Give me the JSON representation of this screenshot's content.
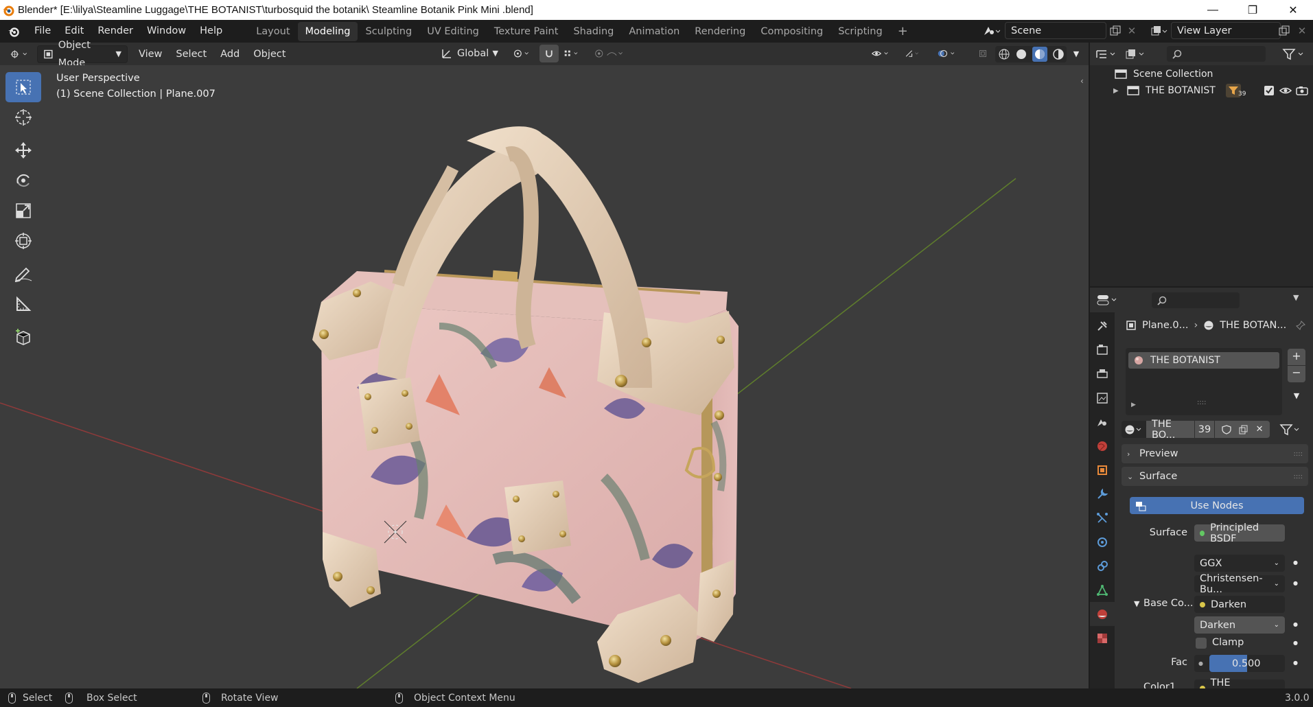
{
  "window": {
    "title": "Blender* [E:\\lilya\\Steamline Luggage\\THE BOTANIST\\turbosquid the botanik\\ Steamline Botanik Pink Mini  .blend]",
    "min_symbol": "—",
    "max_symbol": "❐",
    "close_symbol": "✕"
  },
  "menu": [
    "File",
    "Edit",
    "Render",
    "Window",
    "Help"
  ],
  "workspaces": [
    {
      "label": "Layout",
      "active": false
    },
    {
      "label": "Modeling",
      "active": true
    },
    {
      "label": "Sculpting",
      "active": false
    },
    {
      "label": "UV Editing",
      "active": false
    },
    {
      "label": "Texture Paint",
      "active": false
    },
    {
      "label": "Shading",
      "active": false
    },
    {
      "label": "Animation",
      "active": false
    },
    {
      "label": "Rendering",
      "active": false
    },
    {
      "label": "Compositing",
      "active": false
    },
    {
      "label": "Scripting",
      "active": false
    }
  ],
  "add_workspace": "+",
  "scene": {
    "label": "Scene"
  },
  "view_layer": {
    "label": "View Layer"
  },
  "viewport_header": {
    "mode": "Object Mode",
    "menus": [
      "View",
      "Select",
      "Add",
      "Object"
    ],
    "transform_orientation": "Global"
  },
  "viewport": {
    "info_line1": "User Perspective",
    "info_line2": "(1) Scene Collection | Plane.007"
  },
  "tools": [
    {
      "name": "select-box-tool",
      "icon": "cursor-select-icon",
      "selected": true
    },
    {
      "name": "cursor-tool",
      "icon": "cursor-3d-icon",
      "selected": false
    },
    {
      "name": "move-tool",
      "icon": "move-icon",
      "selected": false
    },
    {
      "name": "rotate-tool",
      "icon": "rotate-icon",
      "selected": false
    },
    {
      "name": "scale-tool",
      "icon": "scale-icon",
      "selected": false
    },
    {
      "name": "transform-tool",
      "icon": "transform-icon",
      "selected": false
    },
    {
      "name": "annotate-tool",
      "icon": "pencil-icon",
      "selected": false
    },
    {
      "name": "measure-tool",
      "icon": "ruler-icon",
      "selected": false
    },
    {
      "name": "add-cube-tool",
      "icon": "add-cube-icon",
      "selected": false
    }
  ],
  "outliner": {
    "root": "Scene Collection",
    "items": [
      {
        "label": "THE BOTANIST",
        "count": "39"
      }
    ]
  },
  "properties": {
    "breadcrumb_object": "Plane.0...",
    "breadcrumb_material": "THE BOTAN...",
    "material_slot": "THE BOTANIST",
    "material_name": "THE BO...",
    "material_users": "39",
    "panels": {
      "preview": "Preview",
      "surface": "Surface"
    },
    "use_nodes": "Use Nodes",
    "surface_label": "Surface",
    "surface_value": "Principled BSDF",
    "distribution": "GGX",
    "subsurface": "Christensen-Bu...",
    "base_color_label": "Base Co...",
    "base_color_value": "Darken",
    "blend_mode": "Darken",
    "clamp_label": "Clamp",
    "fac_label": "Fac",
    "fac_value": "0.500",
    "color1_label": "Color1",
    "color1_value": "THE BOTANIST"
  },
  "statusbar": {
    "select": "Select",
    "box_select": "Box Select",
    "rotate_view": "Rotate View",
    "context_menu": "Object Context Menu",
    "version": "3.0.0"
  },
  "colors": {
    "accent": "#4772b3",
    "viewport_bg": "#3c3c3c",
    "x_axis": "#a33a3a",
    "y_axis": "#6a8f2e",
    "bag_pink": "#e8c2c0",
    "leather": "#e3cdb3"
  }
}
